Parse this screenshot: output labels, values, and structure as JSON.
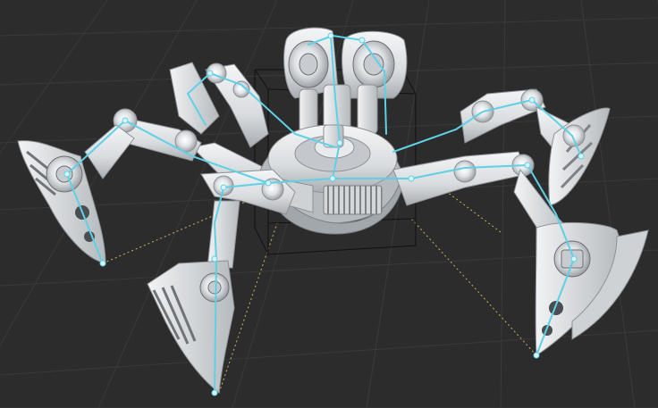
{
  "viewport": {
    "background_color": "#2c2c2c",
    "grid_color": "#3a3a3a",
    "grid_visible": true
  },
  "model": {
    "description_visible_text": "",
    "body_color": "#e6e8ea",
    "shadow_color": "#9ea3a8",
    "dark_panel_color": "#505458"
  },
  "rig": {
    "bone_color": "#5fd0e6",
    "joint_color": "#d8f4fa",
    "ik_line_color": "#c9b25a"
  },
  "bounding_box": {
    "visible": true,
    "color": "#111111"
  }
}
